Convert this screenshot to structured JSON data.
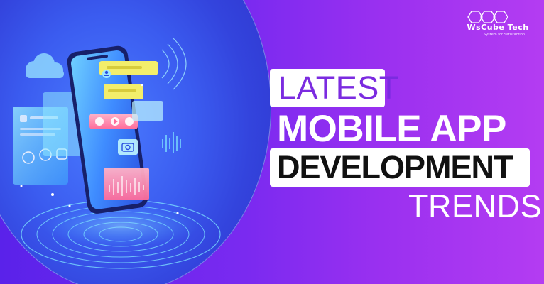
{
  "brand": {
    "name": "WsCube Tech",
    "tagline": "System for Satisfaction"
  },
  "headline": {
    "line1": "LATEST",
    "line2": "MOBILE APP",
    "line3": "DEVELOPMENT",
    "line4": "TRENDS"
  },
  "colors": {
    "background_start": "#5a22ea",
    "background_end": "#b43cf2",
    "latest_text": "#7b2be0",
    "development_text": "#111111",
    "circle": "#3b5cf0",
    "phone_screen": "#4aa0ff",
    "accent_yellow": "#f3ee6b",
    "accent_pink": "#ff6b8a",
    "accent_cyan": "#3fe3ff"
  },
  "icons": [
    "cloud-icon",
    "user-icon",
    "play-icon",
    "camera-icon",
    "hexagon-logo-icon"
  ]
}
